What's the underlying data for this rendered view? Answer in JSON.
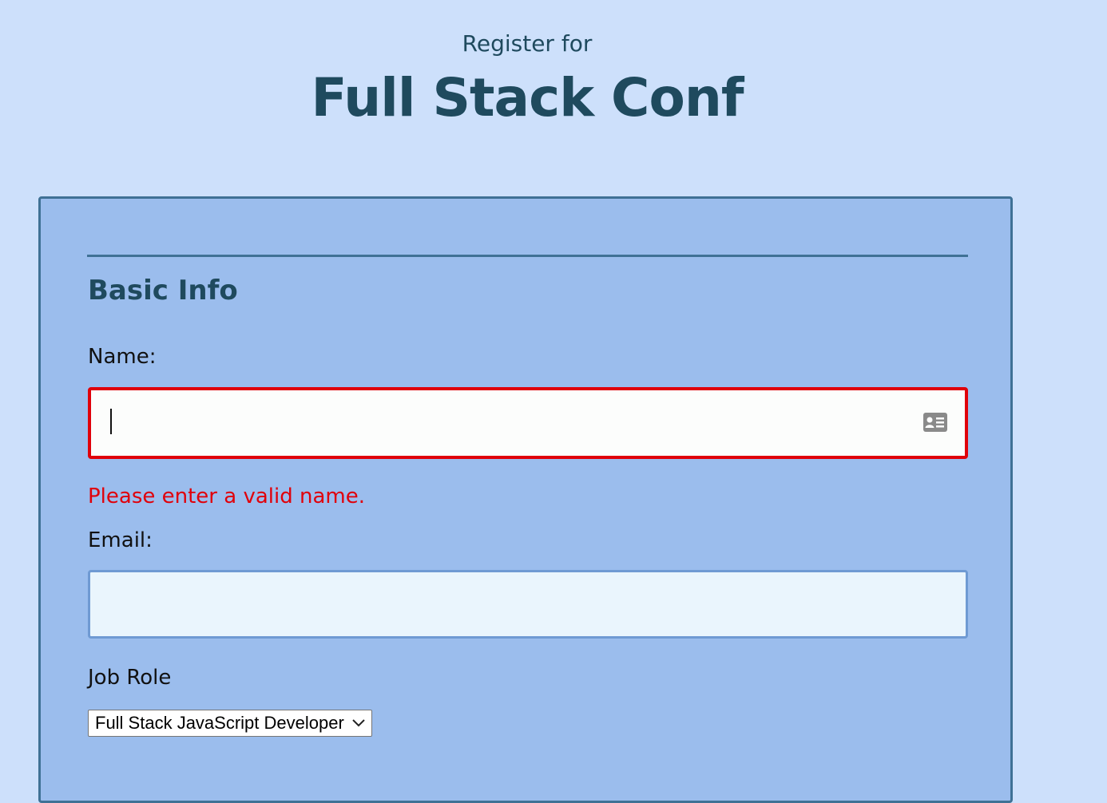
{
  "header": {
    "subtitle": "Register for",
    "title": "Full Stack Conf"
  },
  "form": {
    "section_title": "Basic Info",
    "name": {
      "label": "Name:",
      "value": "",
      "error": "Please enter a valid name."
    },
    "email": {
      "label": "Email:",
      "value": ""
    },
    "job_role": {
      "label": "Job Role",
      "selected": "Full Stack JavaScript Developer"
    }
  },
  "colors": {
    "page_bg": "#cde0fb",
    "card_bg": "#9bbded",
    "card_border": "#3f7195",
    "heading": "#1f4a5e",
    "error": "#e0000a"
  },
  "icons": {
    "name_field": "contact-card-icon",
    "select": "chevron-down-icon"
  }
}
